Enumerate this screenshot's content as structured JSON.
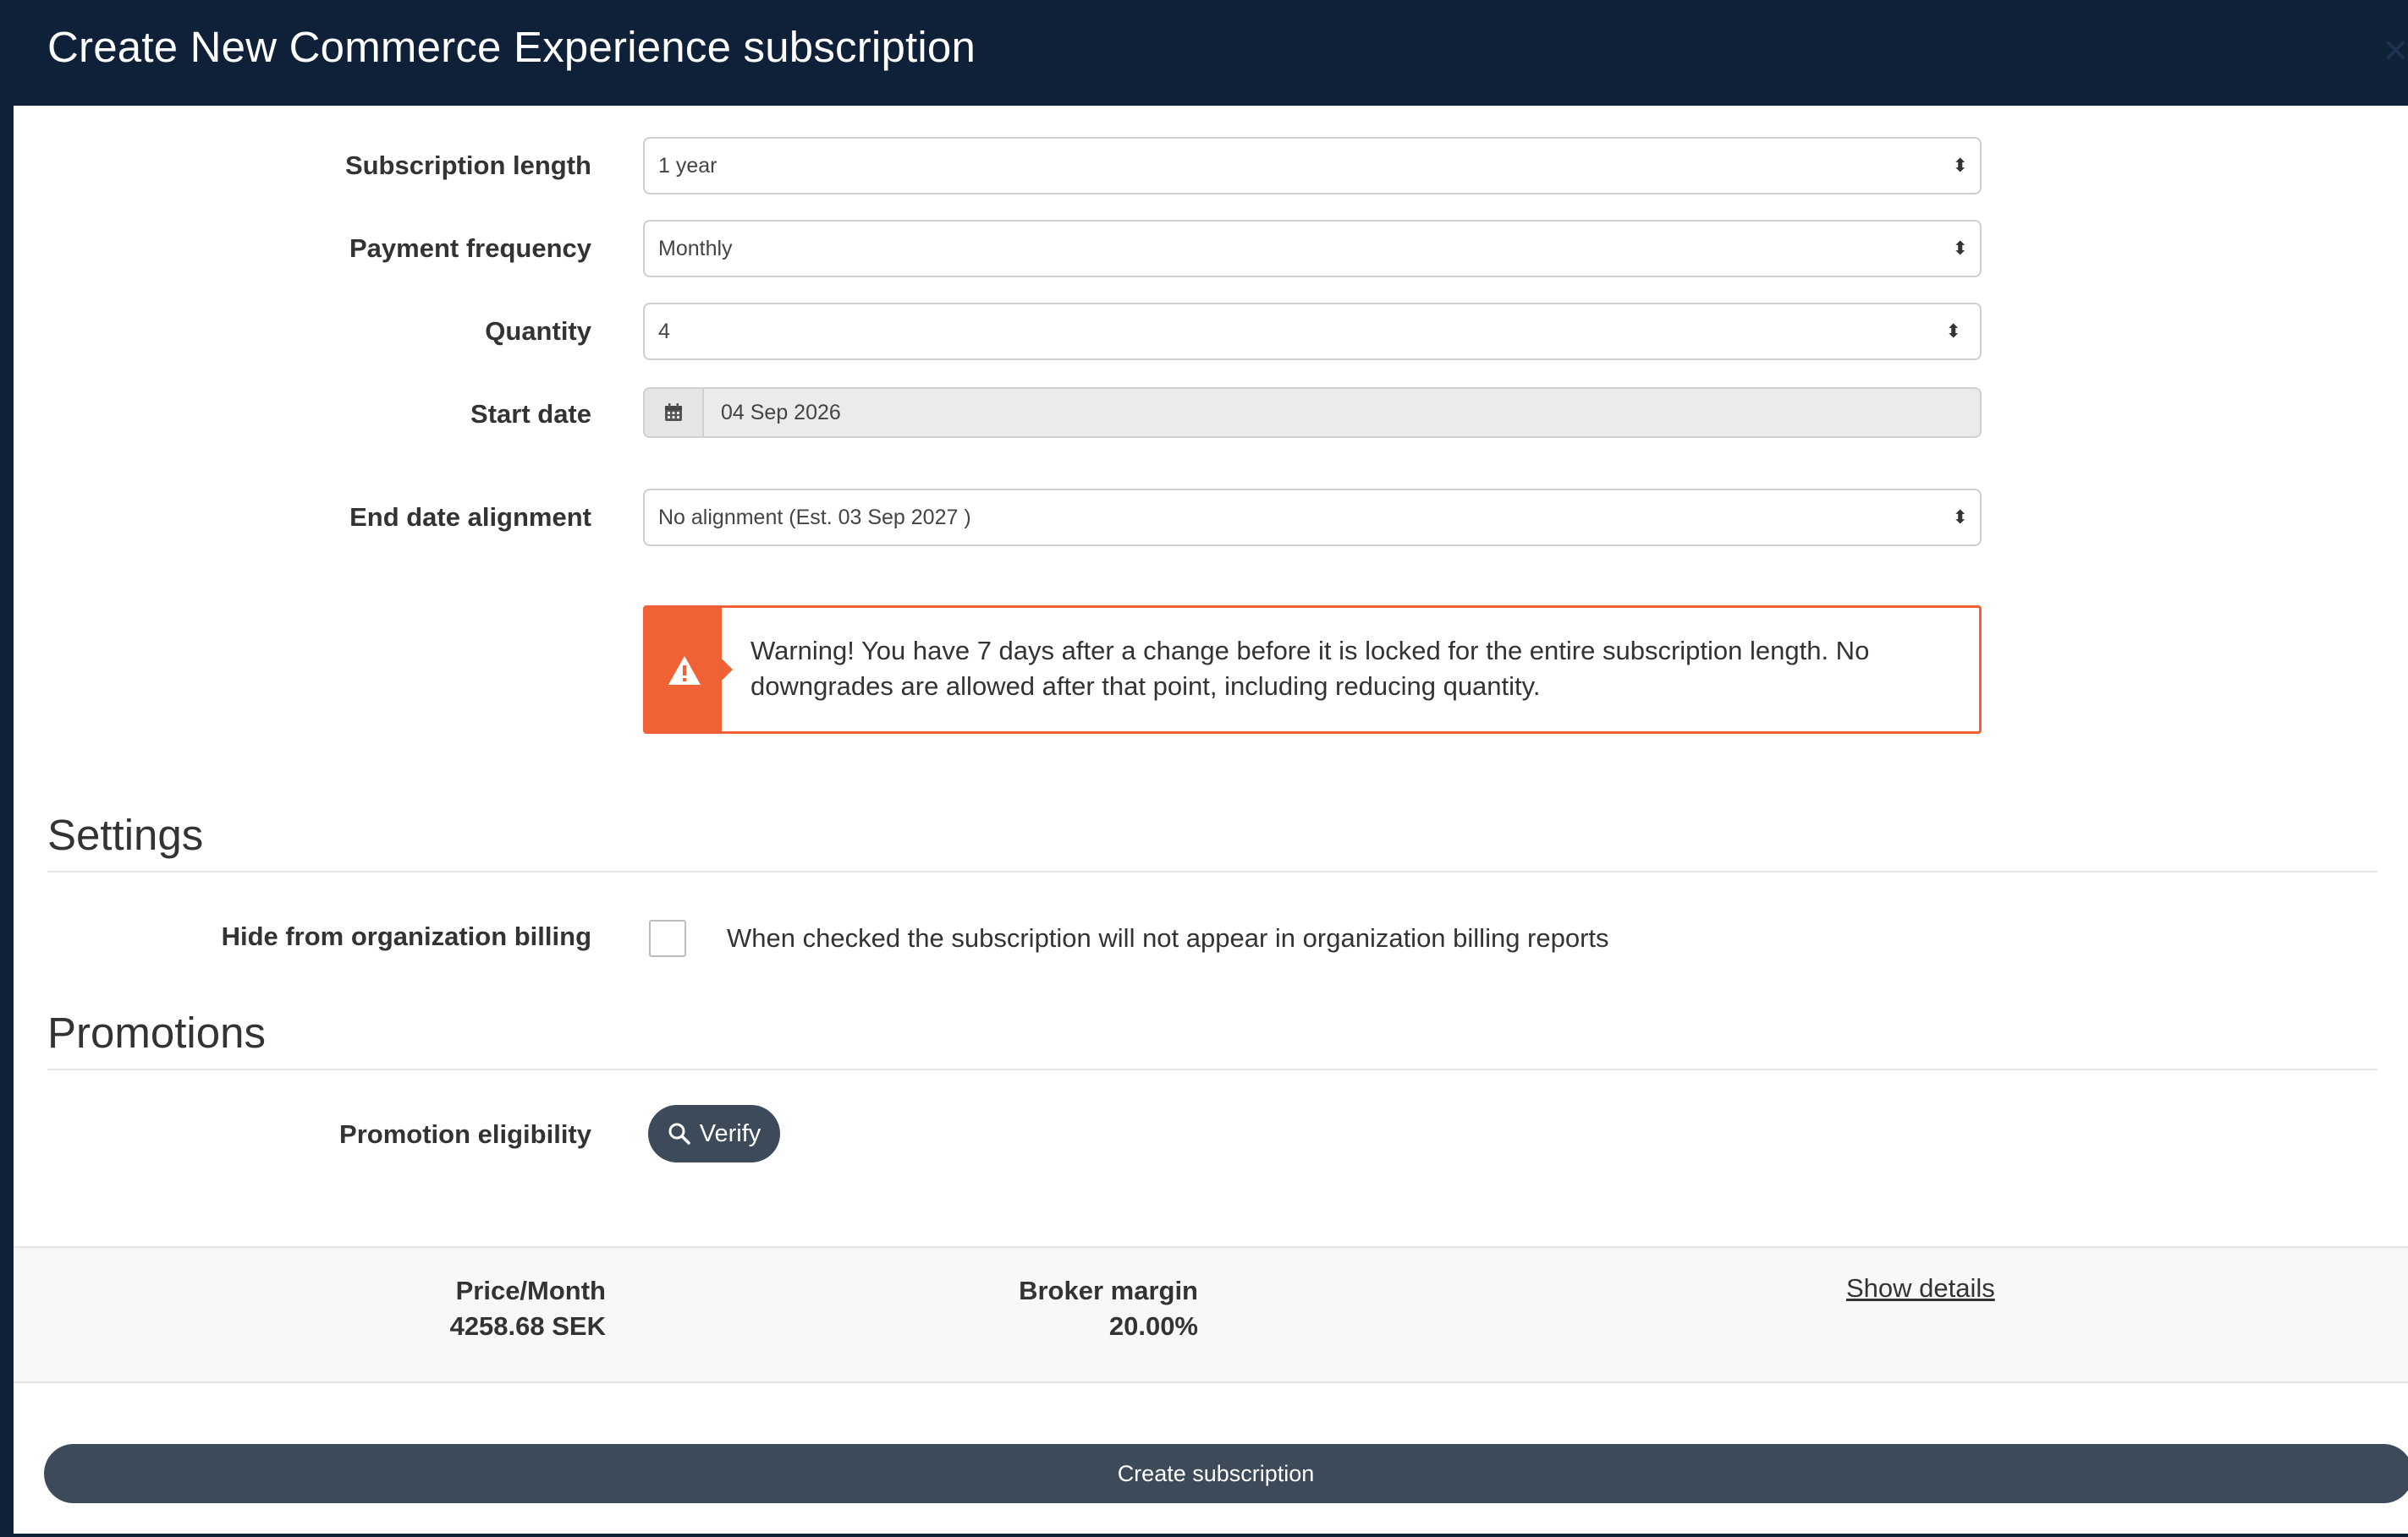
{
  "modal": {
    "title": "Create New Commerce Experience subscription",
    "close_glyph": "×"
  },
  "form": {
    "subscription_length": {
      "label": "Subscription length",
      "value": "1 year"
    },
    "payment_frequency": {
      "label": "Payment frequency",
      "value": "Monthly"
    },
    "quantity": {
      "label": "Quantity",
      "value": "4"
    },
    "start_date": {
      "label": "Start date",
      "value": "04 Sep 2026",
      "icon": "calendar-icon"
    },
    "end_date_alignment": {
      "label": "End date alignment",
      "value": "No alignment (Est. 03 Sep 2027 )"
    }
  },
  "warning": {
    "icon": "warning-icon",
    "text": "Warning! You have 7 days after a change before it is locked for the entire subscription length. No downgrades are allowed after that point, including reducing quantity.",
    "color": "#f06236"
  },
  "settings": {
    "title": "Settings",
    "hide_billing": {
      "label": "Hide from organization billing",
      "checked": false,
      "description": "When checked the subscription will not appear in organization billing reports"
    }
  },
  "promotions": {
    "title": "Promotions",
    "eligibility": {
      "label": "Promotion eligibility",
      "button_label": "Verify",
      "icon": "search-icon"
    }
  },
  "summary": {
    "price_label": "Price/Month",
    "price_value": "4258.68 SEK",
    "margin_label": "Broker margin",
    "margin_value": "20.00%",
    "show_details": "Show details"
  },
  "footer": {
    "create_label": "Create subscription"
  },
  "colors": {
    "header_bg": "#0f2138",
    "button_bg": "#3d4a5a",
    "warning": "#f06236"
  }
}
